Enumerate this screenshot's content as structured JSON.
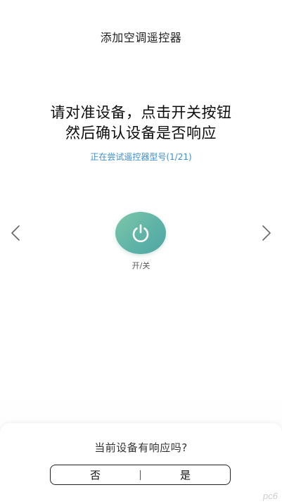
{
  "header": {
    "title": "添加空调遥控器"
  },
  "instruction": {
    "line1": "请对准设备，点击开关按钮",
    "line2": "然后确认设备是否响应"
  },
  "status": {
    "text": "正在尝试遥控器型号(1/21)"
  },
  "power": {
    "icon": "power-icon",
    "label": "开/关"
  },
  "navigation": {
    "prev_icon": "chevron-left-icon",
    "next_icon": "chevron-right-icon"
  },
  "confirm": {
    "question": "当前设备有响应吗?",
    "no_label": "否",
    "yes_label": "是"
  },
  "watermark": {
    "text": "pc6"
  },
  "colors": {
    "accent_green": "#5fb4a7",
    "status_blue": "#3f8fd0"
  }
}
